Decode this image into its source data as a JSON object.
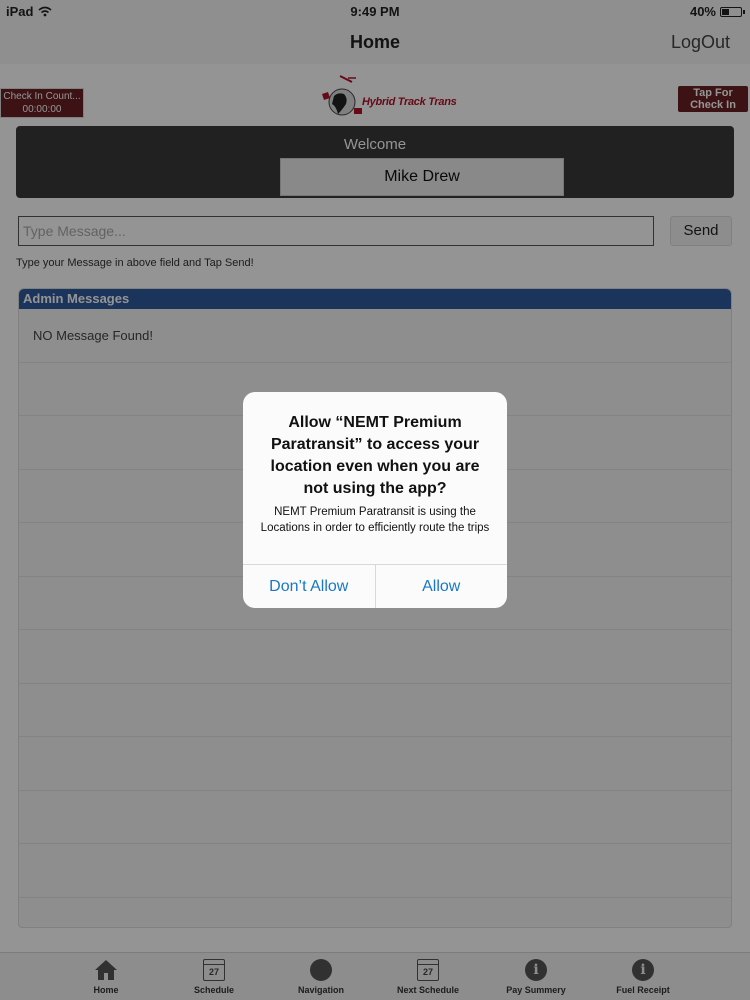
{
  "status_bar": {
    "device": "iPad",
    "time": "9:49 PM",
    "battery": "40%",
    "battery_level": 0.4
  },
  "navbar": {
    "title": "Home",
    "logout": "LogOut"
  },
  "checkin_count": {
    "label": "Check In Count...",
    "timer": "00:00:00"
  },
  "logo": {
    "text": "Hybrid Track Trans"
  },
  "tap_checkin": {
    "line1": "Tap For",
    "line2": "Check In"
  },
  "welcome": {
    "title": "Welcome",
    "user": "Mike Drew"
  },
  "message": {
    "placeholder": "Type Message...",
    "send": "Send",
    "hint": "Type your Message in above field and Tap Send!"
  },
  "admin_messages": {
    "header": "Admin Messages",
    "rows": [
      "NO Message Found!",
      "",
      "",
      "",
      "",
      "",
      "",
      "",
      "",
      "",
      "",
      ""
    ]
  },
  "tabbar": {
    "items": [
      {
        "label": "Home",
        "icon": "home-icon"
      },
      {
        "label": "Schedule",
        "icon": "calendar-icon",
        "day": "27"
      },
      {
        "label": "Navigation",
        "icon": "globe-icon"
      },
      {
        "label": "Next Schedule",
        "icon": "calendar-icon",
        "day": "27"
      },
      {
        "label": "Pay Summery",
        "icon": "info-icon"
      },
      {
        "label": "Fuel Receipt",
        "icon": "info-icon"
      }
    ]
  },
  "alert": {
    "title": "Allow “NEMT Premium Paratransit” to access your location even when you are not using the app?",
    "message": "NEMT Premium Paratransit is using the Locations in order to efficiently route the trips",
    "deny": "Don’t Allow",
    "allow": "Allow"
  }
}
